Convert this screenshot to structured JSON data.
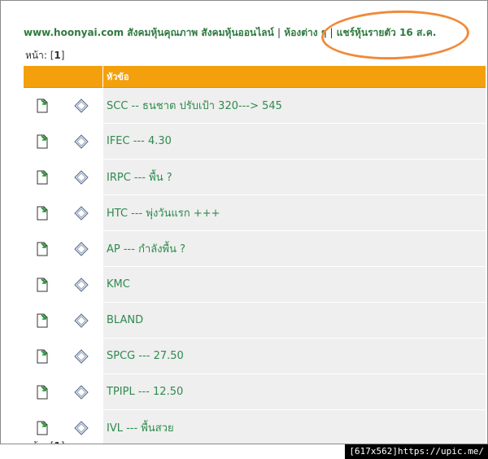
{
  "breadcrumb": {
    "site": "www.hoonyai.com",
    "part1": "สังคมหุ้นคุณภาพ",
    "part2": "สังคมหุ้นออนไลน์",
    "part3": "ห้องต่าง ๆ",
    "part4": "แชร์หุ้นรายตัว 16 ส.ค.",
    "separator": "|"
  },
  "pagination": {
    "label": "หน้า:",
    "current": "1"
  },
  "table": {
    "header": "หัวข้อ",
    "rows": [
      {
        "title": "SCC -- ธนชาต ปรับเป้า 320---> 545"
      },
      {
        "title": "IFEC --- 4.30"
      },
      {
        "title": "IRPC --- พื้น ?"
      },
      {
        "title": "HTC --- พุ่งวันแรก +++"
      },
      {
        "title": "AP --- กำลังพื้น ?"
      },
      {
        "title": "KMC"
      },
      {
        "title": "BLAND"
      },
      {
        "title": "SPCG --- 27.50"
      },
      {
        "title": "TPIPL --- 12.50"
      },
      {
        "title": "IVL --- พื้นสวย"
      }
    ]
  },
  "watermark": "[617x562]https://upic.me/",
  "colors": {
    "header_bg": "#f4a00c",
    "link_green": "#2e8a4e",
    "annotation": "#f08a3a"
  }
}
